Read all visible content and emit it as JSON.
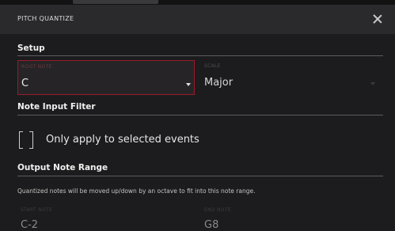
{
  "window": {
    "title": "PITCH QUANTIZE"
  },
  "setup": {
    "heading": "Setup",
    "root_note": {
      "label": "ROOT NOTE",
      "value": "C"
    },
    "scale": {
      "label": "SCALE",
      "value": "Major"
    }
  },
  "note_input_filter": {
    "heading": "Note Input Filter",
    "checkbox_label": "Only apply to selected events",
    "checked": false
  },
  "output_note_range": {
    "heading": "Output Note Range",
    "description": "Quantized notes will be moved up/down by an octave to fit into this note range.",
    "start_note": {
      "label": "START NOTE",
      "value": "C-2"
    },
    "end_note": {
      "label": "END NOTE",
      "value": "G8"
    }
  },
  "colors": {
    "background": "#1c1c1e",
    "titlebar": "#2a2a2c",
    "focus_border": "#9b1b2a"
  }
}
